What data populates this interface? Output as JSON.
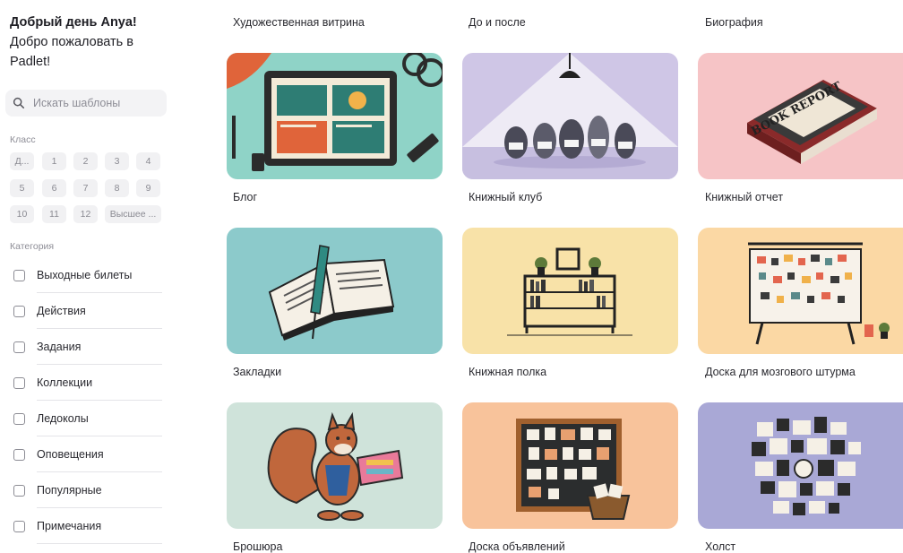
{
  "sidebar": {
    "greeting_line1": "Добрый день Anya!",
    "greeting_line2": "Добро пожаловать в Padlet!",
    "search": {
      "placeholder": "Искать шаблоны",
      "icon": "search-icon"
    },
    "grade_label": "Класс",
    "grades": [
      "Д...",
      "1",
      "2",
      "3",
      "4",
      "5",
      "6",
      "7",
      "8",
      "9",
      "10",
      "11",
      "12",
      "Высшее ..."
    ],
    "category_label": "Категория",
    "categories": [
      "Выходные билеты",
      "Действия",
      "Задания",
      "Коллекции",
      "Ледоколы",
      "Оповещения",
      "Популярные",
      "Примечания"
    ]
  },
  "grid": {
    "top_labels": [
      "Художественная витрина",
      "До и после",
      "Биография"
    ],
    "cards": [
      {
        "label": "Блог",
        "bg": "#8fd3c7"
      },
      {
        "label": "Книжный клуб",
        "bg": "#cfc6e6"
      },
      {
        "label": "Книжный отчет",
        "bg": "#f6c4c6"
      },
      {
        "label": "Закладки",
        "bg": "#8ccacb"
      },
      {
        "label": "Книжная полка",
        "bg": "#f8e2a8"
      },
      {
        "label": "Доска для мозгового штурма",
        "bg": "#fbd8a4"
      },
      {
        "label": "Брошюра",
        "bg": "#cfe3da"
      },
      {
        "label": "Доска объявлений",
        "bg": "#f8c39b"
      },
      {
        "label": "Холст",
        "bg": "#a9a8d6"
      }
    ],
    "book_cover_text": "BOOK REPORT"
  }
}
